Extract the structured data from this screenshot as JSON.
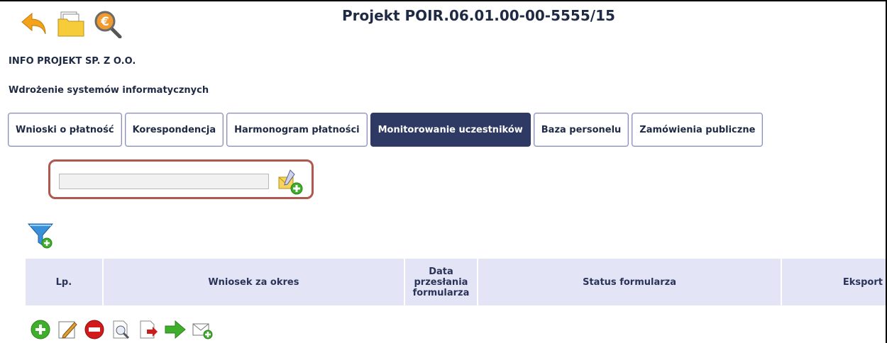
{
  "header": {
    "project_title": "Projekt POIR.06.01.00-00-5555/15",
    "org_name": "INFO PROJEKT SP. Z O.O.",
    "project_name": "Wdrożenie systemów informatycznych",
    "icons": [
      "back-arrow-icon",
      "folder-icon",
      "euro-magnifier-icon"
    ]
  },
  "tabs": [
    {
      "label": "Wnioski o płatność"
    },
    {
      "label": "Korespondencja"
    },
    {
      "label": "Harmonogram płatności"
    },
    {
      "label": "Monitorowanie uczestników",
      "active": true
    },
    {
      "label": "Baza personelu"
    },
    {
      "label": "Zamówienia publiczne"
    }
  ],
  "search": {
    "value": "",
    "placeholder": ""
  },
  "table": {
    "headers": {
      "lp": "Lp.",
      "period": "Wniosek za okres",
      "date": "Data przesłania formularza",
      "status": "Status formularza",
      "export": "Eksport"
    }
  },
  "actions": [
    "add-icon",
    "edit-icon",
    "delete-icon",
    "preview-icon",
    "export-document-icon",
    "send-arrow-icon",
    "mail-add-icon"
  ],
  "colors": {
    "accent_dark": "#2e3a63",
    "header_bg": "#e3e5f6",
    "highlight_border": "#b0574e",
    "green": "#3fae2a",
    "red": "#d11b1b"
  }
}
